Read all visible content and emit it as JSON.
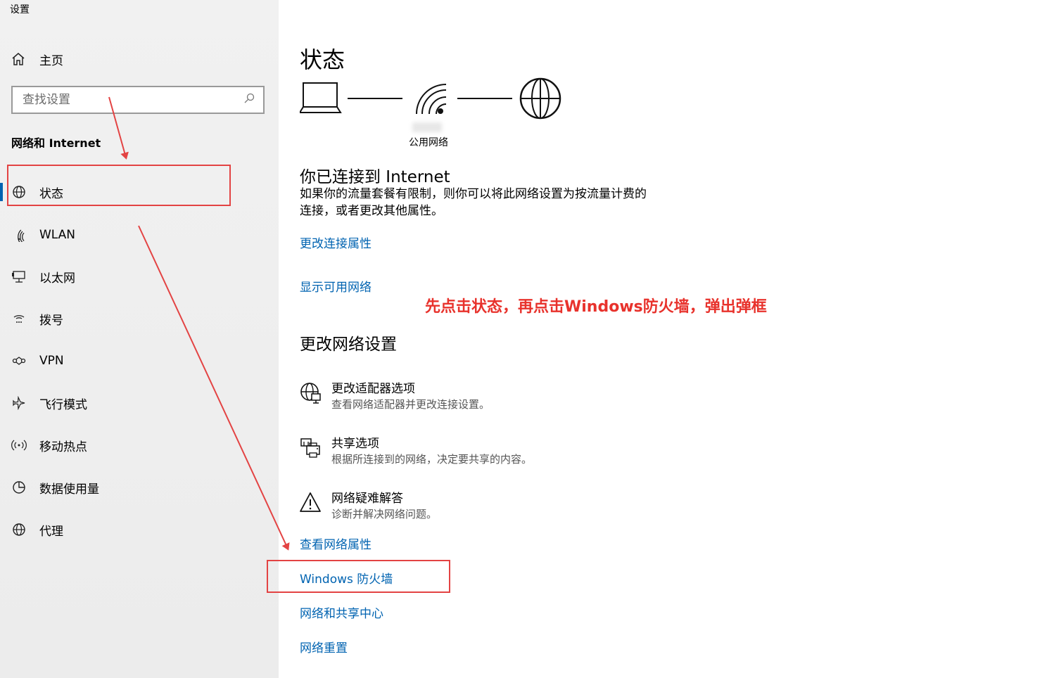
{
  "window": {
    "title": "设置"
  },
  "sidebar": {
    "home_label": "主页",
    "search_placeholder": "查找设置",
    "section_title": "网络和 Internet",
    "items": [
      {
        "label": "状态",
        "icon": "globe-icon"
      },
      {
        "label": "WLAN",
        "icon": "wifi-icon"
      },
      {
        "label": "以太网",
        "icon": "ethernet-icon"
      },
      {
        "label": "拨号",
        "icon": "dialup-icon"
      },
      {
        "label": "VPN",
        "icon": "vpn-icon"
      },
      {
        "label": "飞行模式",
        "icon": "airplane-icon"
      },
      {
        "label": "移动热点",
        "icon": "hotspot-icon"
      },
      {
        "label": "数据使用量",
        "icon": "data-usage-icon"
      },
      {
        "label": "代理",
        "icon": "proxy-globe-icon"
      }
    ]
  },
  "main": {
    "title": "状态",
    "network_label": "公用网络",
    "connected_heading": "你已连接到 Internet",
    "connected_desc_line1": "如果你的流量套餐有限制，则你可以将此网络设置为按流量计费的",
    "connected_desc_line2": "连接，或者更改其他属性。",
    "link_change_connection": "更改连接属性",
    "link_show_networks": "显示可用网络",
    "change_heading": "更改网络设置",
    "options": [
      {
        "title": "更改适配器选项",
        "desc": "查看网络适配器并更改连接设置。",
        "icon": "adapter-icon"
      },
      {
        "title": "共享选项",
        "desc": "根据所连接到的网络，决定要共享的内容。",
        "icon": "sharing-icon"
      },
      {
        "title": "网络疑难解答",
        "desc": "诊断并解决网络问题。",
        "icon": "warning-icon"
      }
    ],
    "links": {
      "view_properties": "查看网络属性",
      "firewall": "Windows 防火墙",
      "sharing_center": "网络和共享中心",
      "reset": "网络重置"
    }
  },
  "annotation": {
    "text": "先点击状态，再点击Windows防火墙，弹出弹框",
    "color": "#e8322c"
  }
}
